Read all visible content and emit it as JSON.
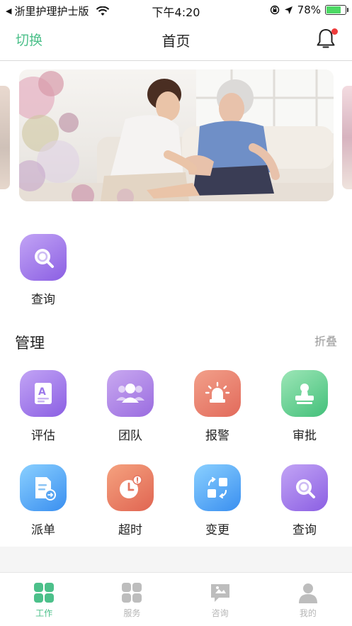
{
  "status_bar": {
    "carrier": "浙里护理护士版",
    "time": "下午4:20",
    "battery": "78%",
    "battery_level": 0.78
  },
  "nav": {
    "switch_label": "切换",
    "title": "首页"
  },
  "quick": {
    "query_label": "查询"
  },
  "management": {
    "title": "管理",
    "fold_label": "折叠",
    "items": [
      {
        "label": "评估",
        "icon": "assessment-icon"
      },
      {
        "label": "团队",
        "icon": "team-icon"
      },
      {
        "label": "报警",
        "icon": "alarm-icon"
      },
      {
        "label": "审批",
        "icon": "approval-icon"
      },
      {
        "label": "派单",
        "icon": "dispatch-icon"
      },
      {
        "label": "超时",
        "icon": "timeout-icon"
      },
      {
        "label": "变更",
        "icon": "change-icon"
      },
      {
        "label": "查询",
        "icon": "search-icon"
      }
    ]
  },
  "tabbar": {
    "items": [
      {
        "label": "工作",
        "icon": "work-grid-icon",
        "active": true
      },
      {
        "label": "服务",
        "icon": "service-grid-icon",
        "active": false
      },
      {
        "label": "咨询",
        "icon": "consult-chat-icon",
        "active": false
      },
      {
        "label": "我的",
        "icon": "profile-icon",
        "active": false
      }
    ]
  },
  "colors": {
    "accent": "#4cc08a",
    "badge": "#ee3b3b"
  }
}
